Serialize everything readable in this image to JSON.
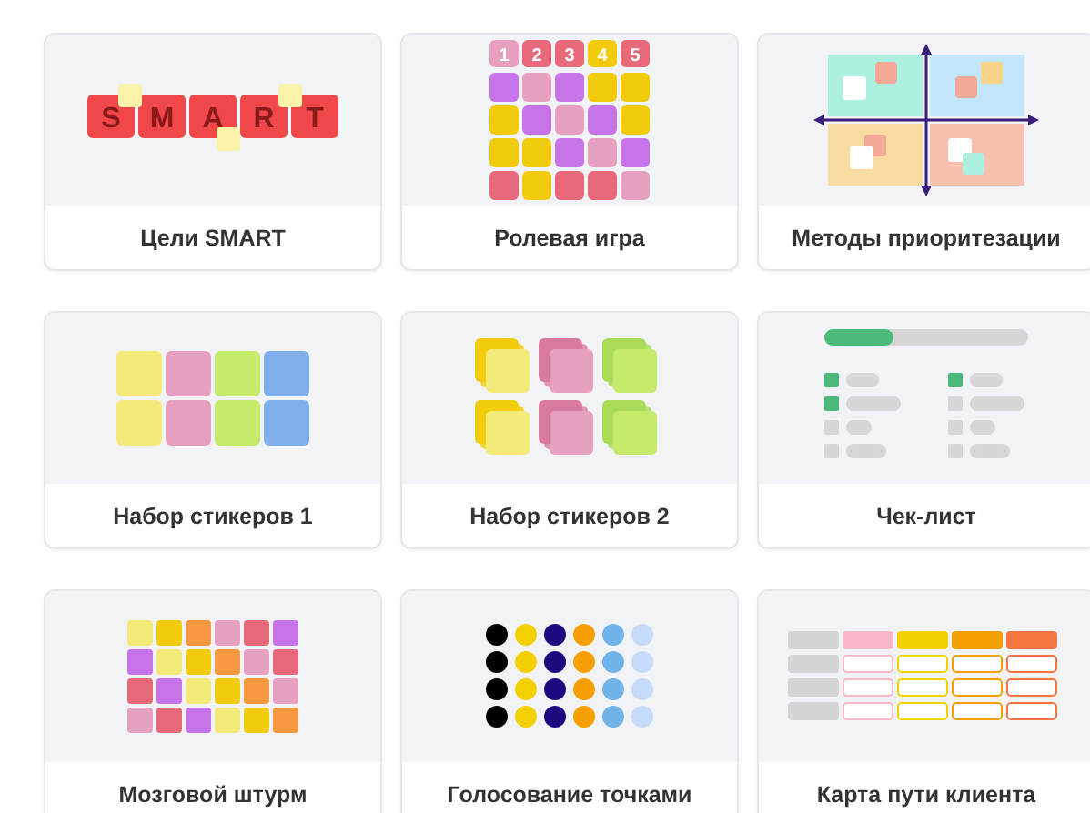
{
  "templates": [
    {
      "kind": "smart",
      "title": "Цели SMART",
      "letters": [
        "S",
        "M",
        "A",
        "R",
        "T"
      ]
    },
    {
      "kind": "roleplay",
      "title": "Ролевая игра",
      "numbers": [
        "1",
        "2",
        "3",
        "4",
        "5"
      ]
    },
    {
      "kind": "matrix",
      "title": "Методы приоритезации"
    },
    {
      "kind": "stickers",
      "title": "Набор стикеров 1"
    },
    {
      "kind": "stacks",
      "title": "Набор стикеров 2"
    },
    {
      "kind": "checklist",
      "title": "Чек-лист"
    },
    {
      "kind": "brainstorm",
      "title": "Мозговой штурм"
    },
    {
      "kind": "dots",
      "title": "Голосование точками"
    },
    {
      "kind": "journey",
      "title": "Карта пути клиента"
    }
  ]
}
